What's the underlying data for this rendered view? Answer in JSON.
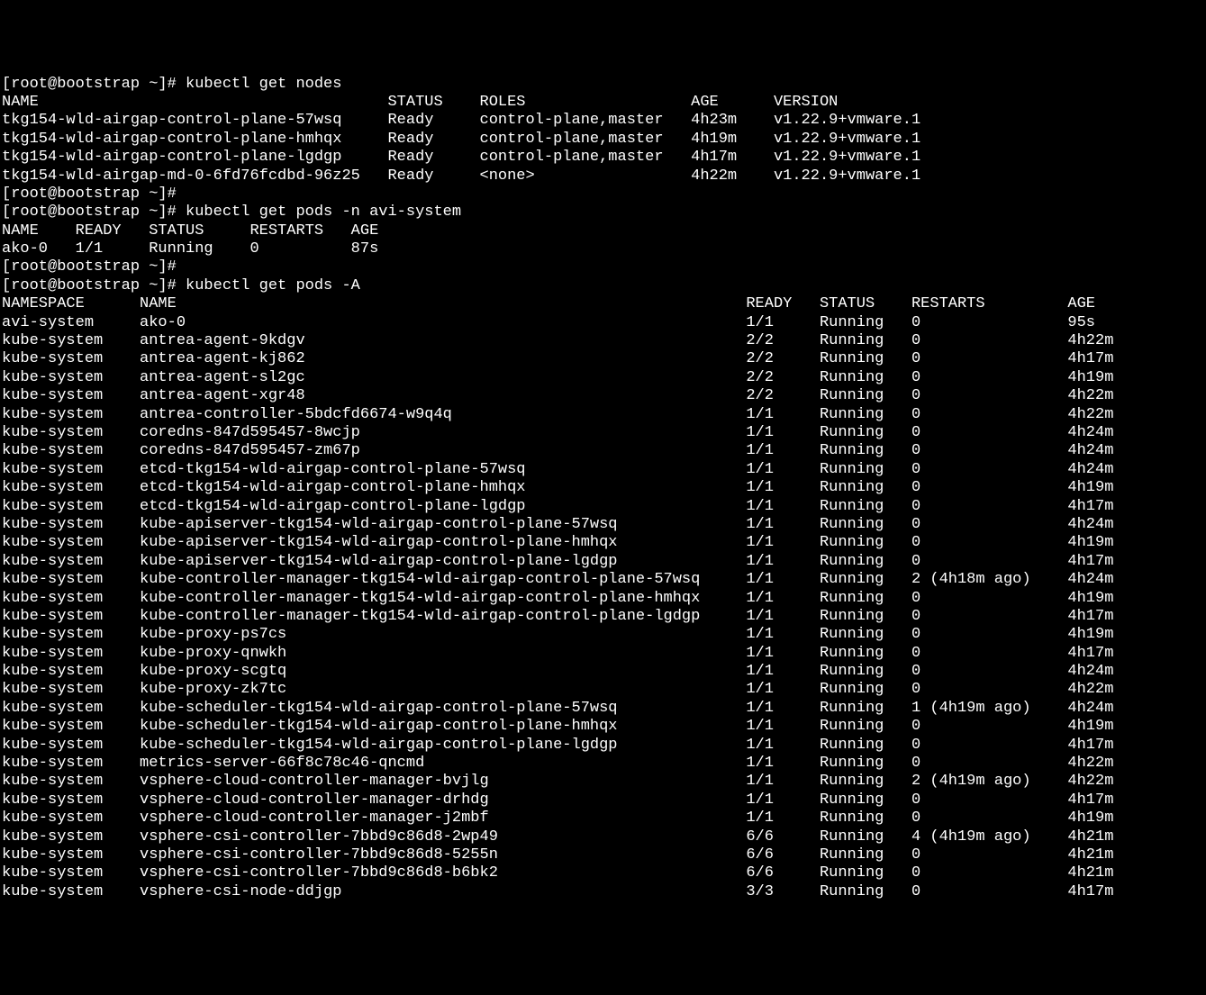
{
  "prompt": "[root@bootstrap ~]#",
  "commands": {
    "getNodes": "kubectl get nodes",
    "getPodsAvi": "kubectl get pods -n avi-system",
    "getPodsAll": "kubectl get pods -A"
  },
  "nodesHeader": {
    "name": "NAME",
    "status": "STATUS",
    "roles": "ROLES",
    "age": "AGE",
    "version": "VERSION"
  },
  "nodes": [
    {
      "name": "tkg154-wld-airgap-control-plane-57wsq",
      "status": "Ready",
      "roles": "control-plane,master",
      "age": "4h23m",
      "version": "v1.22.9+vmware.1"
    },
    {
      "name": "tkg154-wld-airgap-control-plane-hmhqx",
      "status": "Ready",
      "roles": "control-plane,master",
      "age": "4h19m",
      "version": "v1.22.9+vmware.1"
    },
    {
      "name": "tkg154-wld-airgap-control-plane-lgdgp",
      "status": "Ready",
      "roles": "control-plane,master",
      "age": "4h17m",
      "version": "v1.22.9+vmware.1"
    },
    {
      "name": "tkg154-wld-airgap-md-0-6fd76fcdbd-96z25",
      "status": "Ready",
      "roles": "<none>",
      "age": "4h22m",
      "version": "v1.22.9+vmware.1"
    }
  ],
  "aviHeader": {
    "name": "NAME",
    "ready": "READY",
    "status": "STATUS",
    "restarts": "RESTARTS",
    "age": "AGE"
  },
  "aviPods": [
    {
      "name": "ako-0",
      "ready": "1/1",
      "status": "Running",
      "restarts": "0",
      "age": "87s"
    }
  ],
  "allHeader": {
    "namespace": "NAMESPACE",
    "name": "NAME",
    "ready": "READY",
    "status": "STATUS",
    "restarts": "RESTARTS",
    "age": "AGE"
  },
  "allPods": [
    {
      "namespace": "avi-system",
      "name": "ako-0",
      "ready": "1/1",
      "status": "Running",
      "restarts": "0",
      "age": "95s"
    },
    {
      "namespace": "kube-system",
      "name": "antrea-agent-9kdgv",
      "ready": "2/2",
      "status": "Running",
      "restarts": "0",
      "age": "4h22m"
    },
    {
      "namespace": "kube-system",
      "name": "antrea-agent-kj862",
      "ready": "2/2",
      "status": "Running",
      "restarts": "0",
      "age": "4h17m"
    },
    {
      "namespace": "kube-system",
      "name": "antrea-agent-sl2gc",
      "ready": "2/2",
      "status": "Running",
      "restarts": "0",
      "age": "4h19m"
    },
    {
      "namespace": "kube-system",
      "name": "antrea-agent-xgr48",
      "ready": "2/2",
      "status": "Running",
      "restarts": "0",
      "age": "4h22m"
    },
    {
      "namespace": "kube-system",
      "name": "antrea-controller-5bdcfd6674-w9q4q",
      "ready": "1/1",
      "status": "Running",
      "restarts": "0",
      "age": "4h22m"
    },
    {
      "namespace": "kube-system",
      "name": "coredns-847d595457-8wcjp",
      "ready": "1/1",
      "status": "Running",
      "restarts": "0",
      "age": "4h24m"
    },
    {
      "namespace": "kube-system",
      "name": "coredns-847d595457-zm67p",
      "ready": "1/1",
      "status": "Running",
      "restarts": "0",
      "age": "4h24m"
    },
    {
      "namespace": "kube-system",
      "name": "etcd-tkg154-wld-airgap-control-plane-57wsq",
      "ready": "1/1",
      "status": "Running",
      "restarts": "0",
      "age": "4h24m"
    },
    {
      "namespace": "kube-system",
      "name": "etcd-tkg154-wld-airgap-control-plane-hmhqx",
      "ready": "1/1",
      "status": "Running",
      "restarts": "0",
      "age": "4h19m"
    },
    {
      "namespace": "kube-system",
      "name": "etcd-tkg154-wld-airgap-control-plane-lgdgp",
      "ready": "1/1",
      "status": "Running",
      "restarts": "0",
      "age": "4h17m"
    },
    {
      "namespace": "kube-system",
      "name": "kube-apiserver-tkg154-wld-airgap-control-plane-57wsq",
      "ready": "1/1",
      "status": "Running",
      "restarts": "0",
      "age": "4h24m"
    },
    {
      "namespace": "kube-system",
      "name": "kube-apiserver-tkg154-wld-airgap-control-plane-hmhqx",
      "ready": "1/1",
      "status": "Running",
      "restarts": "0",
      "age": "4h19m"
    },
    {
      "namespace": "kube-system",
      "name": "kube-apiserver-tkg154-wld-airgap-control-plane-lgdgp",
      "ready": "1/1",
      "status": "Running",
      "restarts": "0",
      "age": "4h17m"
    },
    {
      "namespace": "kube-system",
      "name": "kube-controller-manager-tkg154-wld-airgap-control-plane-57wsq",
      "ready": "1/1",
      "status": "Running",
      "restarts": "2 (4h18m ago)",
      "age": "4h24m"
    },
    {
      "namespace": "kube-system",
      "name": "kube-controller-manager-tkg154-wld-airgap-control-plane-hmhqx",
      "ready": "1/1",
      "status": "Running",
      "restarts": "0",
      "age": "4h19m"
    },
    {
      "namespace": "kube-system",
      "name": "kube-controller-manager-tkg154-wld-airgap-control-plane-lgdgp",
      "ready": "1/1",
      "status": "Running",
      "restarts": "0",
      "age": "4h17m"
    },
    {
      "namespace": "kube-system",
      "name": "kube-proxy-ps7cs",
      "ready": "1/1",
      "status": "Running",
      "restarts": "0",
      "age": "4h19m"
    },
    {
      "namespace": "kube-system",
      "name": "kube-proxy-qnwkh",
      "ready": "1/1",
      "status": "Running",
      "restarts": "0",
      "age": "4h17m"
    },
    {
      "namespace": "kube-system",
      "name": "kube-proxy-scgtq",
      "ready": "1/1",
      "status": "Running",
      "restarts": "0",
      "age": "4h24m"
    },
    {
      "namespace": "kube-system",
      "name": "kube-proxy-zk7tc",
      "ready": "1/1",
      "status": "Running",
      "restarts": "0",
      "age": "4h22m"
    },
    {
      "namespace": "kube-system",
      "name": "kube-scheduler-tkg154-wld-airgap-control-plane-57wsq",
      "ready": "1/1",
      "status": "Running",
      "restarts": "1 (4h19m ago)",
      "age": "4h24m"
    },
    {
      "namespace": "kube-system",
      "name": "kube-scheduler-tkg154-wld-airgap-control-plane-hmhqx",
      "ready": "1/1",
      "status": "Running",
      "restarts": "0",
      "age": "4h19m"
    },
    {
      "namespace": "kube-system",
      "name": "kube-scheduler-tkg154-wld-airgap-control-plane-lgdgp",
      "ready": "1/1",
      "status": "Running",
      "restarts": "0",
      "age": "4h17m"
    },
    {
      "namespace": "kube-system",
      "name": "metrics-server-66f8c78c46-qncmd",
      "ready": "1/1",
      "status": "Running",
      "restarts": "0",
      "age": "4h22m"
    },
    {
      "namespace": "kube-system",
      "name": "vsphere-cloud-controller-manager-bvjlg",
      "ready": "1/1",
      "status": "Running",
      "restarts": "2 (4h19m ago)",
      "age": "4h22m"
    },
    {
      "namespace": "kube-system",
      "name": "vsphere-cloud-controller-manager-drhdg",
      "ready": "1/1",
      "status": "Running",
      "restarts": "0",
      "age": "4h17m"
    },
    {
      "namespace": "kube-system",
      "name": "vsphere-cloud-controller-manager-j2mbf",
      "ready": "1/1",
      "status": "Running",
      "restarts": "0",
      "age": "4h19m"
    },
    {
      "namespace": "kube-system",
      "name": "vsphere-csi-controller-7bbd9c86d8-2wp49",
      "ready": "6/6",
      "status": "Running",
      "restarts": "4 (4h19m ago)",
      "age": "4h21m"
    },
    {
      "namespace": "kube-system",
      "name": "vsphere-csi-controller-7bbd9c86d8-5255n",
      "ready": "6/6",
      "status": "Running",
      "restarts": "0",
      "age": "4h21m"
    },
    {
      "namespace": "kube-system",
      "name": "vsphere-csi-controller-7bbd9c86d8-b6bk2",
      "ready": "6/6",
      "status": "Running",
      "restarts": "0",
      "age": "4h21m"
    },
    {
      "namespace": "kube-system",
      "name": "vsphere-csi-node-ddjgp",
      "ready": "3/3",
      "status": "Running",
      "restarts": "0",
      "age": "4h17m"
    }
  ],
  "cols": {
    "nodes": {
      "name": 42,
      "status": 10,
      "roles": 23,
      "age": 9
    },
    "avi": {
      "name": 8,
      "ready": 8,
      "status": 11,
      "restarts": 11
    },
    "all": {
      "namespace": 15,
      "name": 66,
      "ready": 8,
      "status": 10,
      "restarts": 17
    }
  }
}
